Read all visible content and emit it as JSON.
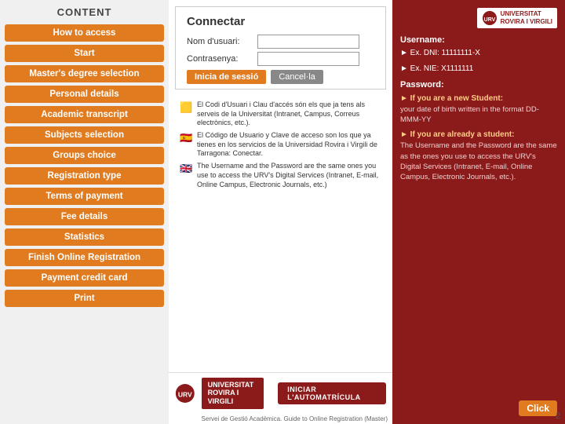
{
  "sidebar": {
    "title": "CONTENT",
    "items": [
      {
        "label": "How to access",
        "active": false
      },
      {
        "label": "Start",
        "active": false
      },
      {
        "label": "Master's degree selection",
        "active": false
      },
      {
        "label": "Personal details",
        "active": false
      },
      {
        "label": "Academic transcript",
        "active": false
      },
      {
        "label": "Subjects selection",
        "active": false
      },
      {
        "label": "Groups choice",
        "active": false
      },
      {
        "label": "Registration type",
        "active": false
      },
      {
        "label": "Terms of payment",
        "active": false
      },
      {
        "label": "Fee details",
        "active": false
      },
      {
        "label": "Statistics",
        "active": false
      },
      {
        "label": "Finish Online Registration",
        "active": false
      },
      {
        "label": "Payment credit card",
        "active": false
      },
      {
        "label": "Print",
        "active": false
      }
    ]
  },
  "connectar": {
    "title": "Connectar",
    "username_label": "Nom d'usuari:",
    "password_label": "Contrasenya:",
    "login_button": "Inicia de sessió",
    "cancel_button": "Cancel·la"
  },
  "content": {
    "cat_text": "El Codi d'Usuari i Clau d'accés són els que ja tens als serveis de la Universitat (Intranet, Campus, Correus electrònics, etc.).",
    "es_text": "El Código de Usuario y Clave de acceso son los que ya tienes en los servicios de la Universidad Rovira i Virgili de Tarragona: Conectar.",
    "en_text": "The Username and the Password are the same ones you use to access the URV's Digital Services (Intranet, E-mail, Online Campus, Electronic Journals, etc.)"
  },
  "right_panel": {
    "username_label": "Username:",
    "dni_example": "► Ex. DNI: 11111111-X",
    "nie_example": "► Ex. NIE: X1111111",
    "password_label": "Password:",
    "new_student_title": "► If you are a new Student:",
    "new_student_text": "your date of birth written in the format DD-MMM-YY",
    "existing_student_title": "► If you are already a student:",
    "existing_student_text": "The Username and the Password are the same as the ones you use to access the URV's Digital Services (Intranet, E-mail, Online Campus, Electronic Journals, etc.).",
    "click_label": "Click"
  },
  "bottom": {
    "urv_name": "UNIVERSITAT\nROVIRA I VIRGILI",
    "iniciar_label": "INICIAR L'AUTOMATRÍCULA",
    "footer_text": "Servei de Gestió Acadèmica. Guide to Online Registration (Master)",
    "page_number": "2"
  }
}
